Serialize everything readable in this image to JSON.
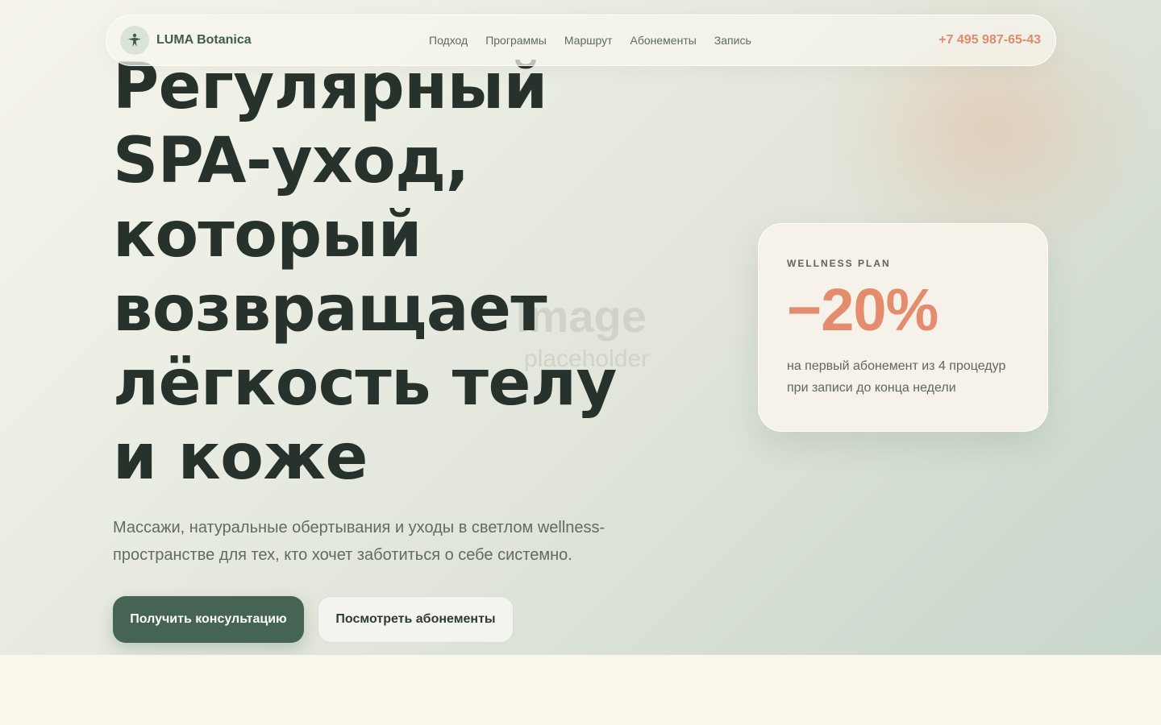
{
  "brand": {
    "name": "LUMA Botanica",
    "logo_icon": "leaf-person-icon"
  },
  "nav": {
    "links": [
      "Подход",
      "Программы",
      "Маршрут",
      "Абонементы",
      "Запись"
    ],
    "phone": "+7 495 987-65-43"
  },
  "hero": {
    "headline_lines": [
      "Регулярный",
      "SPA-уход,",
      "который",
      "возвращает",
      "лёгкость телу",
      "и коже"
    ],
    "subtitle": "Массажи, натуральные обертывания и уходы в светлом wellness-пространстве для тех, кто хочет заботиться о себе системно.",
    "primary_button": "Получить консультацию",
    "secondary_button": "Посмотреть абонементы",
    "image_placeholder": {
      "main": "Image",
      "sub": "placeholder"
    }
  },
  "promo": {
    "kicker": "WELLNESS PLAN",
    "value": "−20%",
    "text": "на первый абонемент из 4 процедур при записи до конца недели"
  },
  "colors": {
    "accent": "#e48c6e",
    "primary_green": "#466453",
    "heading": "#26322b",
    "background": "#f8f4ea"
  }
}
